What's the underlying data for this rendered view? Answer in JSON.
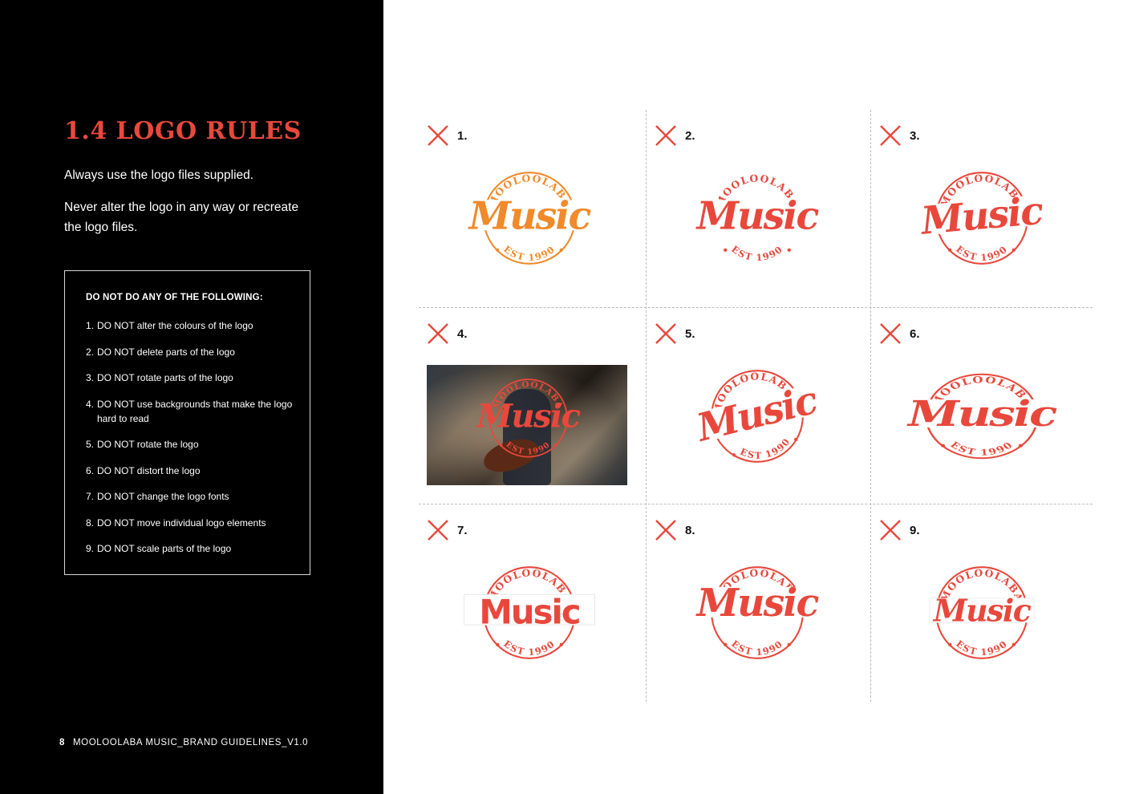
{
  "page": {
    "title": "1.4  LOGO RULES",
    "intro_1": "Always use the logo files supplied.",
    "intro_2": "Never alter the logo in any way or recreate the logo files.",
    "footer_page": "8",
    "footer_text": "MOOLOOLABA MUSIC_BRAND GUIDELINES_V1.0"
  },
  "rules": {
    "heading": "DO NOT DO ANY OF THE FOLLOWING:",
    "items": [
      {
        "num": "1.",
        "text": "DO NOT alter the colours of the logo"
      },
      {
        "num": "2.",
        "text": "DO NOT delete parts of the logo"
      },
      {
        "num": "3.",
        "text": "DO NOT rotate parts of the logo"
      },
      {
        "num": "4.",
        "text": "DO NOT use backgrounds that make the logo hard to read"
      },
      {
        "num": "5.",
        "text": "DO NOT rotate the logo"
      },
      {
        "num": "6.",
        "text": "DO NOT distort the logo"
      },
      {
        "num": "7.",
        "text": "DO NOT change the logo fonts"
      },
      {
        "num": "8.",
        "text": "DO NOT move individual logo elements"
      },
      {
        "num": "9.",
        "text": "DO NOT scale parts of the logo"
      }
    ]
  },
  "examples": [
    {
      "label": "1."
    },
    {
      "label": "2."
    },
    {
      "label": "3."
    },
    {
      "label": "4."
    },
    {
      "label": "5."
    },
    {
      "label": "6."
    },
    {
      "label": "7."
    },
    {
      "label": "8."
    },
    {
      "label": "9."
    }
  ],
  "logo": {
    "top_text": "MOOLOOLABA",
    "word": "Music",
    "bottom_text": "EST 1990"
  },
  "colors": {
    "brand_red": "#e8483c",
    "wrong_orange": "#f08a2a",
    "x_mark": "#e8483c"
  }
}
